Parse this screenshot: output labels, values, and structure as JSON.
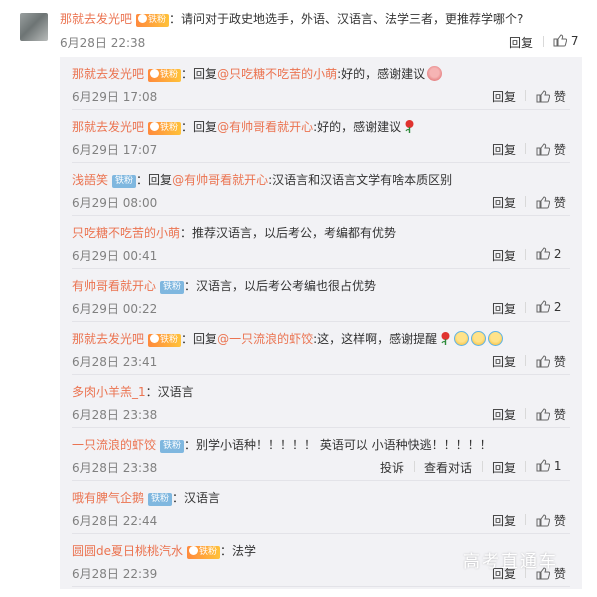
{
  "comment": {
    "author": "那就去发光吧",
    "text": "请问对于政史地选手，外语、汉语言、法学三者，更推荐学哪个?",
    "time": "6月28日 22:38",
    "reply_label": "回复",
    "like_count": "7"
  },
  "labels": {
    "reply": "回复",
    "like": "赞",
    "report": "投诉",
    "view_conversation": "查看对话",
    "fan_badge": "铁粉",
    "vip_badge": "铁粉"
  },
  "replies": [
    {
      "author": "那就去发光吧",
      "badge": "vip",
      "prefix": "回复",
      "mention": "@只吃糖不吃苦的小萌",
      "text": ":好的，感谢建议",
      "emoji": "pig",
      "time": "6月29日 17:08",
      "likes": "赞"
    },
    {
      "author": "那就去发光吧",
      "badge": "vip",
      "prefix": "回复",
      "mention": "@有帅哥看就开心",
      "text": ":好的，感谢建议",
      "emoji": "rose",
      "time": "6月29日 17:07",
      "likes": "赞"
    },
    {
      "author": "浅語笑",
      "badge": "fan",
      "prefix": "回复",
      "mention": "@有帅哥看就开心",
      "text": ":汉语言和汉语言文学有啥本质区别",
      "emoji": "",
      "time": "6月29日 08:00",
      "likes": "赞"
    },
    {
      "author": "只吃糖不吃苦的小萌",
      "badge": "",
      "prefix": "",
      "mention": "",
      "text": "推荐汉语言，以后考公，考编都有优势",
      "emoji": "",
      "time": "6月29日 00:41",
      "likes": "2"
    },
    {
      "author": "有帅哥看就开心",
      "badge": "fan",
      "prefix": "",
      "mention": "",
      "text": "汉语言，以后考公考编也很占优势",
      "emoji": "",
      "time": "6月29日 00:22",
      "likes": "2"
    },
    {
      "author": "那就去发光吧",
      "badge": "vip",
      "prefix": "回复",
      "mention": "@一只流浪的虾饺",
      "text": ":这，这样啊，感谢提醒",
      "emoji": "rose-laugh",
      "time": "6月28日 23:41",
      "likes": "赞"
    },
    {
      "author": "多肉小羊羔_1",
      "badge": "",
      "prefix": "",
      "mention": "",
      "text": "汉语言",
      "emoji": "",
      "time": "6月28日 23:38",
      "likes": "赞"
    },
    {
      "author": "一只流浪的虾饺",
      "badge": "fan",
      "prefix": "",
      "mention": "",
      "text": "别学小语种！！！！！ 英语可以 小语种快逃！！！！！",
      "emoji": "",
      "time": "6月28日 23:38",
      "likes": "1",
      "extra": true
    },
    {
      "author": "哦有脾气企鹅",
      "badge": "fan",
      "prefix": "",
      "mention": "",
      "text": "汉语言",
      "emoji": "",
      "time": "6月28日 22:44",
      "likes": "赞"
    },
    {
      "author": "圆圆de夏日桃桃汽水",
      "badge": "vip",
      "prefix": "",
      "mention": "",
      "text": "法学",
      "emoji": "",
      "time": "6月28日 22:39",
      "likes": "赞"
    }
  ],
  "watermark": "高考直通车",
  "colors": {
    "name": "#eb7350",
    "panel": "#f2f2f5",
    "fan_badge": "#7fb7df"
  }
}
